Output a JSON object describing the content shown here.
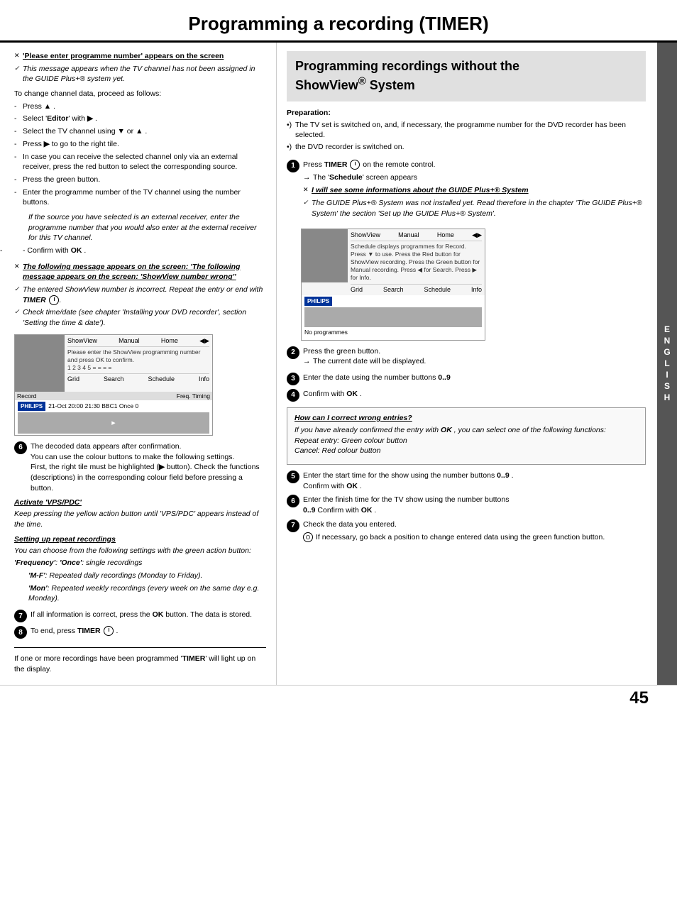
{
  "page": {
    "title": "Programming a recording (TIMER)",
    "page_number": "45"
  },
  "left_col": {
    "section1": {
      "heading": "'Please enter programme number' appears on the screen",
      "check1": "This message appears when the TV channel has not been assigned in the GUIDE Plus+® system yet.",
      "to_change": "To change channel data, proceed as follows:",
      "steps": [
        "Press ▲ .",
        "Select 'Editor' with ▶ .",
        "Select the TV channel using ▼ or ▲ .",
        "Press ▶ to go to the right tile.",
        "In case you can receive the selected channel only via an external receiver, press the red button to select the corresponding source.",
        "Press the green button.",
        "Enter the programme number of the TV channel using the number buttons.",
        "If the source you have selected is an external receiver, enter the programme number that you would also enter at the external receiver for this TV channel.",
        "Confirm with  OK  ."
      ]
    },
    "section2": {
      "heading": "The following message appears on the screen: 'ShowView number wrong'",
      "check1": "The entered ShowView number is incorrect. Repeat the entry or end with TIMER .",
      "check2": "Check time/date (see chapter 'Installing your DVD recorder', section 'Setting the time & date')."
    },
    "tv_screen": {
      "menu_items": [
        "ShowView",
        "Manual",
        "",
        "Home",
        "◀▶"
      ],
      "text_line1": "Please enter the ShowView programming number",
      "text_line2": "and press OK to confirm.",
      "text_line3": "1 2 3 4 5 = = = =",
      "row2_items": [
        "Grid",
        "Search",
        "Schedule",
        "Info"
      ],
      "record_label": "Record",
      "record_data": "21-Oct  20:00   21:30  BBC1     Once  0",
      "freq_timing": "Freq.  Timing"
    },
    "step6": {
      "number": "6",
      "text": "The decoded data appears after confirmation.\nYou can use the colour buttons to make the following settings.\nFirst, the right tile must be highlighted (▶ button). Check the functions (descriptions) in the corresponding colour field before pressing a button."
    },
    "activate_vps": {
      "heading": "Activate 'VPS/PDC'",
      "text": "Keep pressing the yellow action button until 'VPS/PDC' appears instead of the time."
    },
    "setting_repeat": {
      "heading": "Setting up repeat recordings",
      "text": "You can choose from the following settings with the green action button:",
      "frequency_label": "'Frequency':",
      "once_label": "'Once':",
      "once_text": "single recordings",
      "mf_label": "'M-F':",
      "mf_text": "Repeated daily recordings (Monday to Friday).",
      "mon_label": "'Mon':",
      "mon_text": "Repeated weekly recordings (every week on the same day e.g. Monday)."
    },
    "step7_left": {
      "number": "7",
      "text": "If all information is correct, press the  OK  button. The data is stored."
    },
    "step8_left": {
      "number": "8",
      "text": "To end, press  TIMER  ."
    },
    "bottom_note": "If one or more recordings have been programmed 'TIMER' will light up on the display."
  },
  "right_col": {
    "heading": "Programming recordings without the ShowView® System",
    "preparation_label": "Preparation:",
    "prep_items": [
      "The TV set is switched on, and, if necessary, the programme number for the DVD recorder has been selected.",
      "the DVD recorder is switched on."
    ],
    "step1": {
      "number": "1",
      "text": "Press  TIMER  on the remote control.",
      "arrow": "The 'Schedule' screen appears",
      "x_heading": "I will see some informations about the GUIDE Plus+® System",
      "check": "The GUIDE Plus+® System was not installed yet. Read therefore in the chapter 'The GUIDE Plus+® System' the section 'Set up the GUIDE Plus+® System'."
    },
    "tv_screen2": {
      "menu_items": [
        "ShowView",
        "Manual",
        "",
        "Home",
        "◀▶"
      ],
      "row2_items": [
        "Grid",
        "Search",
        "Schedule",
        "Info"
      ],
      "text": "Schedule displays programmes for Record. Press ▼ to use. Press the Red button for ShowView recording. Press the Green button for Manual recording. Press ◀ for Search. Press ▶ for Info.",
      "no_programmes": "No programmes"
    },
    "step2": {
      "number": "2",
      "text": "Press the green button.",
      "arrow": "The current date will be displayed."
    },
    "step3": {
      "number": "3",
      "text": "Enter the date using the number buttons  0..9"
    },
    "step4": {
      "number": "4",
      "text": "Confirm with  OK  ."
    },
    "correct_box": {
      "title": "How can I correct wrong entries?",
      "text": "If you have already confirmed the entry with  OK , you can select one of the following functions:\nRepeat entry: Green colour button\nCancel: Red colour button"
    },
    "step5": {
      "number": "5",
      "text": "Enter the start time for the show using the number buttons  0..9 .\nConfirm with  OK  ."
    },
    "step6": {
      "number": "6",
      "text": "Enter the finish time for the TV show using the number buttons\n0..9  Confirm with  OK  ."
    },
    "step7": {
      "number": "7",
      "text": "Check the data you entered.",
      "sub_o": "If necessary, go back a position to change entered data using the green function button."
    }
  },
  "english_label": "ENGLISH"
}
